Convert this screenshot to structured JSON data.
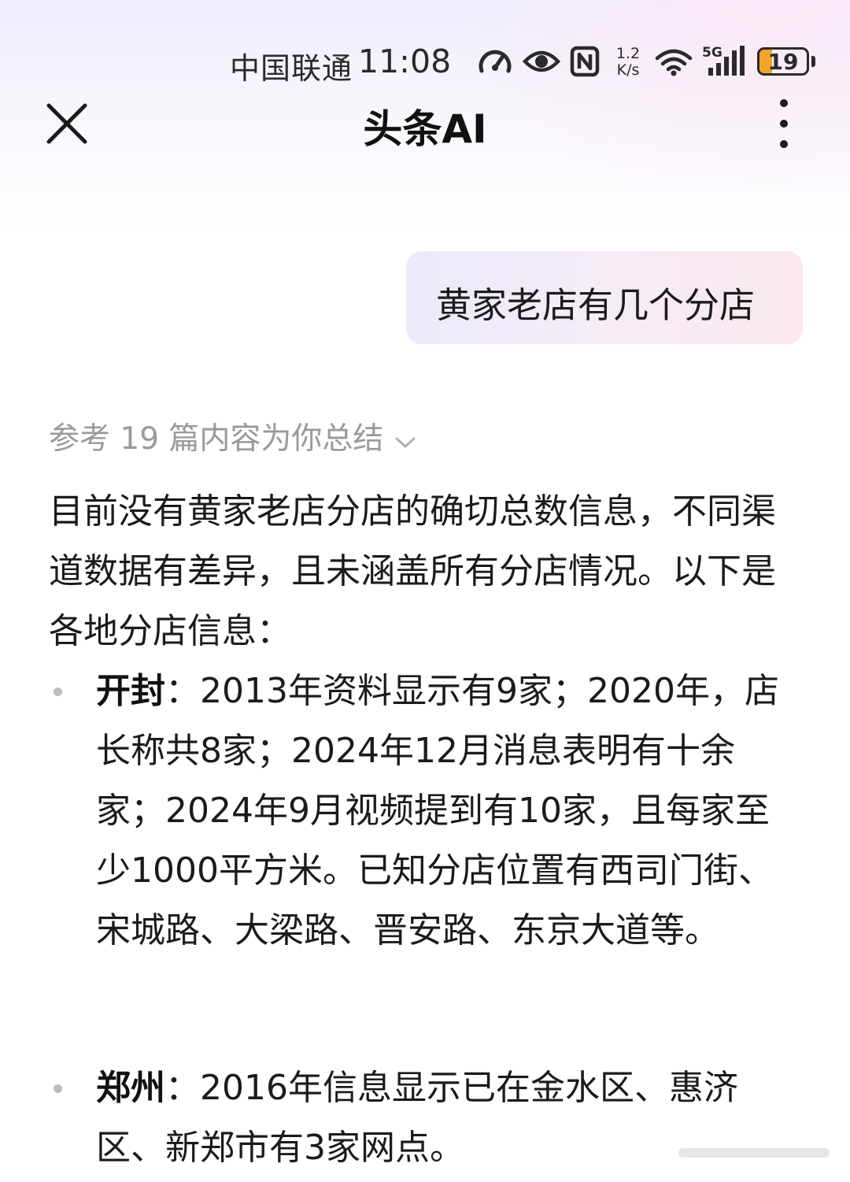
{
  "status_bar": {
    "carrier": "中国联通",
    "time": "11:08",
    "network_speed_value": "1.2",
    "network_speed_unit": "K/s",
    "network_type": "5G",
    "battery_level": "19",
    "icons": [
      "speedometer-icon",
      "eye-icon",
      "nfc-icon",
      "wifi-icon",
      "signal-icon",
      "battery-icon"
    ],
    "battery_color": "#f1a52b"
  },
  "nav": {
    "title": "头条AI",
    "close_icon": "close-icon",
    "more_icon": "more-vertical-icon"
  },
  "chat": {
    "user_message": "黄家老店有几个分店",
    "reference_summary": "参考 19 篇内容为你总结",
    "answer_intro": "目前没有黄家老店分店的确切总数信息，不同渠道数据有差异，且未涵盖所有分店情况。以下是各地分店信息：",
    "items": [
      {
        "label": "开封",
        "text": "：2013年资料显示有9家；2020年，店长称共8家；2024年12月消息表明有十余家；2024年9月视频提到有10家，且每家至少1000平方米。已知分店位置有西司门街、宋城路、大梁路、晋安路、东京大道等。"
      },
      {
        "label": "郑州",
        "text": "：2016年信息显示已在金水区、惠济区、新郑市有3家网点。"
      }
    ]
  },
  "colors": {
    "accent_gradient_start": "#ece9fb",
    "accent_gradient_end": "#fbe7ee",
    "muted_text": "#9a9a9a"
  }
}
